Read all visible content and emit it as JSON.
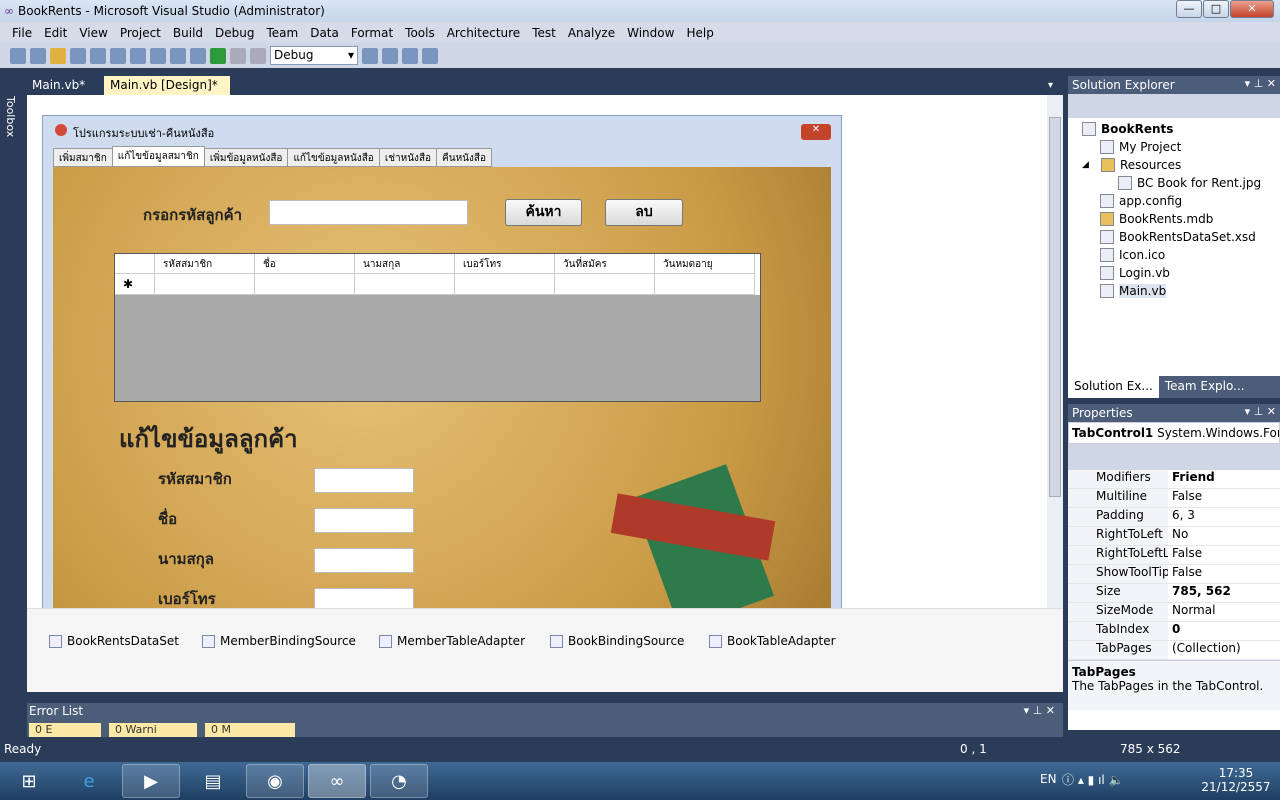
{
  "window": {
    "title": "BookRents - Microsoft Visual Studio (Administrator)",
    "min": "—",
    "max": "□",
    "close": "✕"
  },
  "menu": [
    "File",
    "Edit",
    "View",
    "Project",
    "Build",
    "Debug",
    "Team",
    "Data",
    "Format",
    "Tools",
    "Architecture",
    "Test",
    "Analyze",
    "Window",
    "Help"
  ],
  "toolbar": {
    "config": "Debug"
  },
  "toolbox_label": "Toolbox",
  "doc_tabs": [
    "Main.vb*",
    "Main.vb [Design]*"
  ],
  "form": {
    "title": "โปรแกรมระบบเช่า-คืนหนังสือ",
    "tabs": [
      "เพิ่มสมาชิก",
      "แก้ไขข้อมูลสมาชิก",
      "เพิ่มข้อมูลหนังสือ",
      "แก้ไขข้อมูลหนังสือ",
      "เช่าหนังสือ",
      "คืนหนังสือ"
    ],
    "search_label": "กรอกรหัสลูกค้า",
    "search_button": "ค้นหา",
    "delete_button": "ลบ",
    "grid_columns": [
      "รหัสสมาชิก",
      "ชื่อ",
      "นามสกุล",
      "เบอร์โทร",
      "วันที่สมัคร",
      "วันหมดอายุ"
    ],
    "new_row_marker": "✱",
    "edit_heading": "แก้ไขข้อมูลลูกค้า",
    "fields": [
      "รหัสสมาชิก",
      "ชื่อ",
      "นามสกุล",
      "เบอร์โทร"
    ]
  },
  "tray": [
    "BookRentsDataSet",
    "MemberBindingSource",
    "MemberTableAdapter",
    "BookBindingSource",
    "BookTableAdapter"
  ],
  "error_list": {
    "title": "Error List",
    "tabs": [
      "0 E",
      "0 Warni",
      "0 M"
    ]
  },
  "status": {
    "text": "Ready",
    "position": "0 , 1",
    "size": "785 x 562"
  },
  "solution_explorer": {
    "title": "Solution Explorer",
    "project": "BookRents",
    "items": [
      {
        "label": "My Project",
        "depth": 1
      },
      {
        "label": "Resources",
        "depth": 1
      },
      {
        "label": "BC Book for Rent.jpg",
        "depth": 2
      },
      {
        "label": "app.config",
        "depth": 1
      },
      {
        "label": "BookRents.mdb",
        "depth": 1
      },
      {
        "label": "BookRentsDataSet.xsd",
        "depth": 1
      },
      {
        "label": "Icon.ico",
        "depth": 1
      },
      {
        "label": "Login.vb",
        "depth": 1
      },
      {
        "label": "Main.vb",
        "depth": 1
      }
    ],
    "tabs": [
      "Solution Ex...",
      "Team Explo..."
    ]
  },
  "properties": {
    "title": "Properties",
    "object": "TabControl1",
    "type": "System.Windows.For",
    "rows": [
      [
        "Modifiers",
        "Friend"
      ],
      [
        "Multiline",
        "False"
      ],
      [
        "Padding",
        "6, 3"
      ],
      [
        "RightToLeft",
        "No"
      ],
      [
        "RightToLeftLa",
        "False"
      ],
      [
        "ShowToolTip",
        "False"
      ],
      [
        "Size",
        "785, 562"
      ],
      [
        "SizeMode",
        "Normal"
      ],
      [
        "TabIndex",
        "0"
      ],
      [
        "TabPages",
        "(Collection)"
      ]
    ],
    "desc_title": "TabPages",
    "desc": "The TabPages in the TabControl."
  },
  "taskbar": {
    "lang": "EN",
    "time": "17:35",
    "date": "21/12/2557"
  },
  "lang_indicator": "EN"
}
